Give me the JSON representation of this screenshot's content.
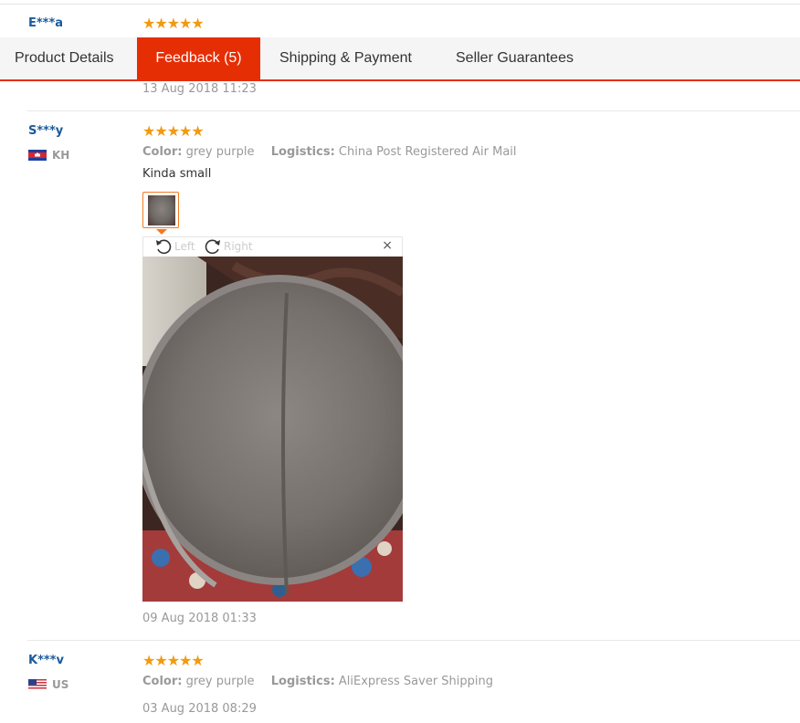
{
  "reviews": [
    {
      "user": "E***a",
      "stars": "★★★★★",
      "date": "13 Aug 2018 11:23"
    },
    {
      "user": "S***y",
      "stars": "★★★★★",
      "country": "KH",
      "color_label": "Color:",
      "color_value": "grey purple",
      "logistics_label": "Logistics:",
      "logistics_value": "China Post Registered Air Mail",
      "comment": "Kinda small",
      "viewer": {
        "left_label": "Left",
        "right_label": "Right",
        "close_label": "×"
      },
      "date": "09 Aug 2018 01:33"
    },
    {
      "user": "K***v",
      "stars": "★★★★★",
      "country": "US",
      "color_label": "Color:",
      "color_value": "grey purple",
      "logistics_label": "Logistics:",
      "logistics_value": "AliExpress Saver Shipping",
      "date": "03 Aug 2018 08:29"
    }
  ],
  "tabs": [
    {
      "label": "Product Details",
      "active": false
    },
    {
      "label": "Feedback (5)",
      "active": true
    },
    {
      "label": "Shipping & Payment",
      "active": false
    },
    {
      "label": "Seller Guarantees",
      "active": false
    }
  ],
  "colors": {
    "accent": "#e62e04",
    "star": "#f29a0f",
    "username": "#1a5b9c"
  }
}
